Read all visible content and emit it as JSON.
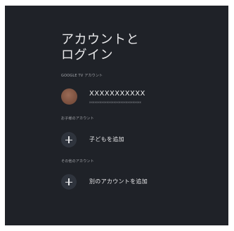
{
  "page": {
    "title": "アカウントと\nログイン"
  },
  "sections": {
    "google_tv_account_label": "GOOGLE TV アカウント",
    "kids_accounts_label": "お子様のアカウント",
    "other_accounts_label": "その他のアカウント"
  },
  "account": {
    "name": "XXXXXXXXXXX",
    "email": "xxxxxxxxxxxxxxxxxxxxxxxxxxxxxx"
  },
  "actions": {
    "add_child_label": "子どもを追加",
    "add_other_account_label": "別のアカウントを追加"
  },
  "colors": {
    "background": "#1f2228",
    "button_circle": "#2f343d",
    "avatar": "#7d5240"
  },
  "icons": {
    "add": "plus-icon"
  }
}
